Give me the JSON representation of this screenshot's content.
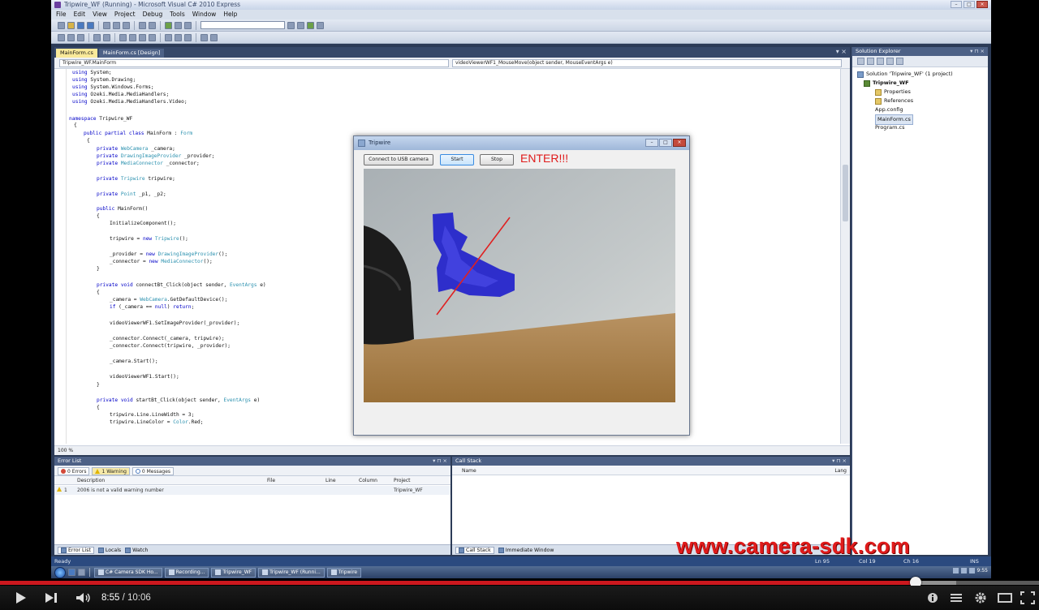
{
  "vs": {
    "window_title": "Tripwire_WF (Running) - Microsoft Visual C# 2010 Express",
    "menu": [
      "File",
      "Edit",
      "View",
      "Project",
      "Debug",
      "Tools",
      "Window",
      "Help"
    ],
    "toolbar_combo": "",
    "tabs": [
      "MainForm.cs",
      "MainForm.cs [Design]"
    ],
    "nav_left": "Tripwire_WF.MainForm",
    "nav_right": "videoViewerWF1_MouseMove(object sender, MouseEventArgs e)",
    "zoom": "100 %",
    "code_lines": [
      "using System;",
      "using System.Drawing;",
      "using System.Windows.Forms;",
      "using Ozeki.Media.MediaHandlers;",
      "using Ozeki.Media.MediaHandlers.Video;",
      "namespace Tripwire_WF",
      "{",
      "public partial class MainForm : Form",
      "{",
      "private WebCamera _camera;",
      "private DrawingImageProvider _provider;",
      "private MediaConnector _connector;",
      "private Tripwire tripwire;",
      "private Point _p1, _p2;",
      "public MainForm()",
      "{",
      "InitializeComponent();",
      "tripwire = new Tripwire();",
      "_provider = new DrawingImageProvider();",
      "_connector = new MediaConnector();",
      "}",
      "private void connectBt_Click(object sender, EventArgs e)",
      "{",
      "_camera = WebCamera.GetDefaultDevice();",
      "if (_camera == null) return;",
      "videoViewerWF1.SetImageProvider(_provider);",
      "_connector.Connect(_camera, tripwire);",
      "_connector.Connect(tripwire, _provider);",
      "_camera.Start();",
      "videoViewerWF1.Start();",
      "}",
      "private void startBt_Click(object sender, EventArgs e)",
      "{",
      "tripwire.Line.LineWidth = 3;",
      "tripwire.LineColor = Color.Red;"
    ],
    "tripwire_form": {
      "title": "Tripwire",
      "connect_button": "Connect to USB camera",
      "start_button": "Start",
      "stop_button": "Stop",
      "enter_text": "ENTER!!!"
    },
    "solution_explorer": {
      "title": "Solution Explorer",
      "items": [
        "Solution 'Tripwire_WF' (1 project)",
        "Tripwire_WF",
        "Properties",
        "References",
        "App.config",
        "MainForm.cs",
        "Program.cs"
      ]
    },
    "error_list": {
      "title": "Error List",
      "errors_tab": "0 Errors",
      "warnings_tab": "1 Warning",
      "messages_tab": "0 Messages",
      "columns": [
        "Description",
        "File",
        "Line",
        "Column",
        "Project"
      ],
      "rows": [
        {
          "num": "1",
          "description": "2006 is not a valid warning number",
          "project": "Tripwire_WF"
        }
      ]
    },
    "call_stack": {
      "title": "Call Stack",
      "columns": [
        "Name",
        "Lang"
      ]
    },
    "bottom_tabs_left": [
      "Error List",
      "Locals",
      "Watch"
    ],
    "bottom_tabs_right": [
      "Call Stack",
      "Immediate Window"
    ],
    "status": {
      "ready": "Ready",
      "ln": "Ln 95",
      "col": "Col 19",
      "ch": "Ch 16",
      "ins": "INS"
    },
    "taskbar": [
      "C# Camera SDK Ho...",
      "Recording...",
      "Tripwire_WF",
      "Tripwire_WF (Runni...",
      "Tripwire"
    ],
    "tray_time": "9:55"
  },
  "watermark": "www.camera-sdk.com",
  "player": {
    "current_time": "8:55",
    "separator": " / ",
    "duration": "10:06",
    "progress": 0.881,
    "buffered": 0.92,
    "accent": "#cc181e"
  }
}
